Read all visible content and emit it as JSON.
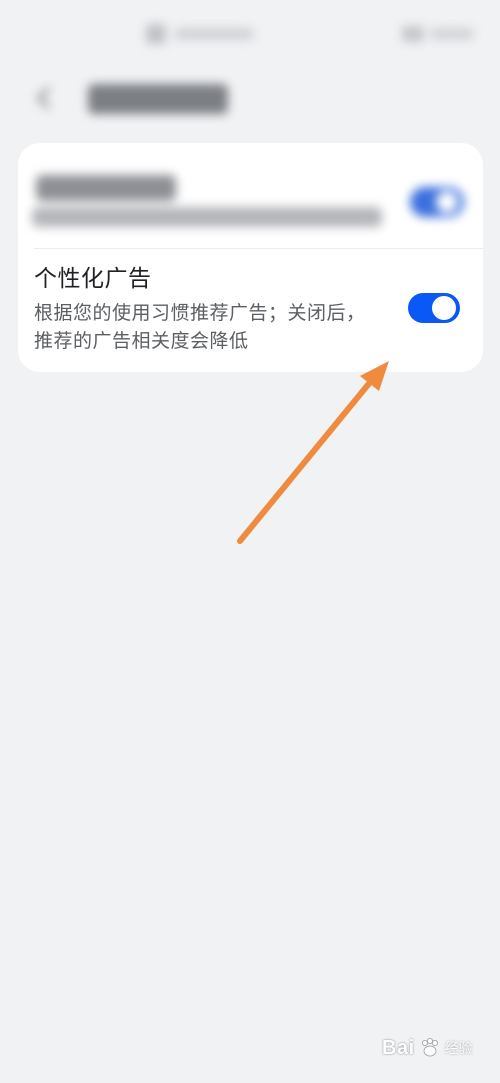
{
  "settings": {
    "personalized_ads": {
      "title": "个性化广告",
      "description": "根据您的使用习惯推荐广告；关闭后，推荐的广告相关度会降低",
      "enabled": true
    }
  },
  "colors": {
    "background": "#f1f2f4",
    "card": "#ffffff",
    "toggle_on": "#0a59f7",
    "annotation_arrow": "#f08a3e"
  },
  "icons": {
    "back": "back-arrow-icon",
    "annotation": "annotation-arrow-icon"
  },
  "watermark": {
    "brand": "Bai",
    "paw": "paw-icon",
    "suffix": "经验"
  }
}
